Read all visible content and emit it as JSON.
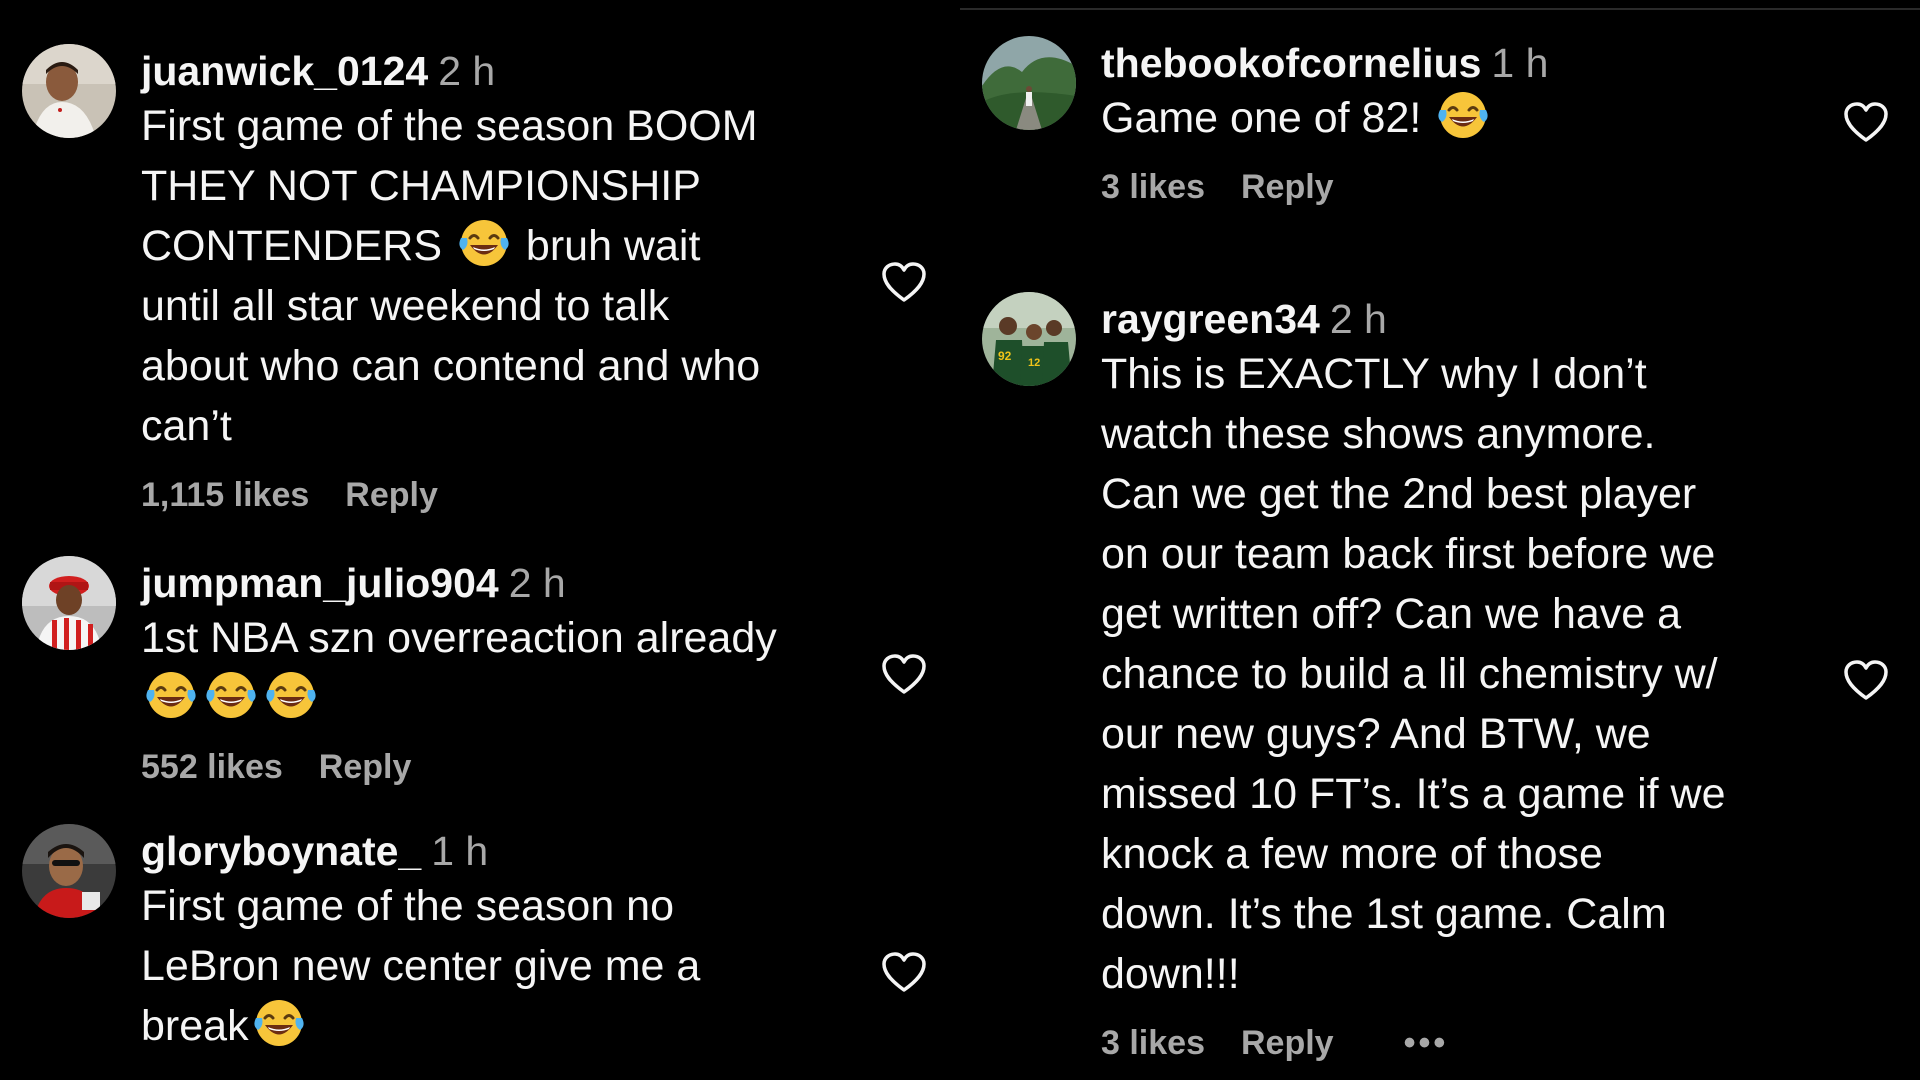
{
  "left_column": {
    "comments": [
      {
        "username": "juanwick_0124",
        "time": "2 h",
        "lines": [
          "First game of the season BOOM",
          "THEY NOT CHAMPIONSHIP",
          [
            "CONTENDERS ",
            "emoji",
            " bruh wait"
          ],
          "until all star weekend to talk",
          "about who can contend and who",
          "can’t"
        ],
        "likes": "1,115 likes",
        "reply": "Reply"
      },
      {
        "username": "jumpman_julio904",
        "time": "2 h",
        "lines": [
          "1st NBA szn overreaction already",
          [
            "emoji",
            "emoji",
            "emoji"
          ]
        ],
        "likes": "552 likes",
        "reply": "Reply"
      },
      {
        "username": "gloryboynate_",
        "time": "1 h",
        "lines": [
          "First game of the season no",
          "LeBron new center give me a",
          [
            "break",
            "emoji"
          ]
        ],
        "likes": "",
        "reply": ""
      }
    ]
  },
  "right_column": {
    "comments": [
      {
        "username": "thebookofcornelius",
        "time": "1 h",
        "lines": [
          [
            "Game one of 82! ",
            "emoji"
          ]
        ],
        "likes": "3 likes",
        "reply": "Reply"
      },
      {
        "username": "raygreen34",
        "time": "2 h",
        "lines": [
          "This is EXACTLY why I don’t",
          "watch these shows anymore.",
          "Can we get the 2nd best player",
          "on our team back first before we",
          "get written off? Can we have a",
          "chance to build a lil chemistry w/",
          "our new guys? And BTW, we",
          "missed 10 FT’s. It’s a game if we",
          "knock a few more of those",
          "down. It’s the 1st game. Calm",
          "down!!!"
        ],
        "likes": "3 likes",
        "reply": "Reply",
        "more": "•••"
      }
    ]
  },
  "icons": {
    "heart": "heart-outline-icon",
    "emoji": "face-with-tears-of-joy-emoji"
  },
  "colors": {
    "background": "#000000",
    "text_primary": "#f5f5f5",
    "text_secondary": "#a8a8a8"
  }
}
